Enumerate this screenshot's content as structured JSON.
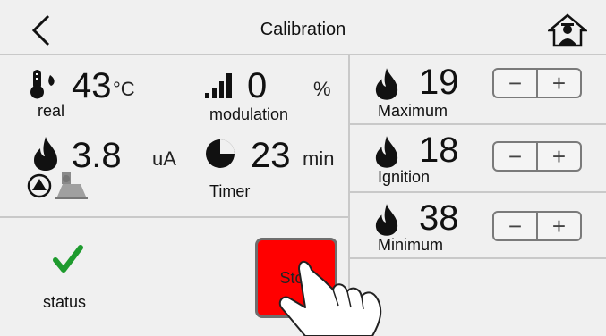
{
  "header": {
    "title": "Calibration"
  },
  "readings": {
    "temperature": {
      "value": "43",
      "unit": "°C",
      "label": "real"
    },
    "modulation": {
      "value": "0",
      "unit": "%",
      "label": "modulation"
    },
    "flame_current": {
      "value": "3.8",
      "unit": "uA"
    },
    "timer": {
      "value": "23",
      "unit": "min",
      "label": "Timer"
    }
  },
  "status": {
    "label": "status",
    "state": "ok"
  },
  "stop_button": {
    "label": "Stop"
  },
  "settings": [
    {
      "value": "19",
      "label": "Maximum",
      "minus": "−",
      "plus": "+"
    },
    {
      "value": "18",
      "label": "Ignition",
      "minus": "−",
      "plus": "+"
    },
    {
      "value": "38",
      "label": "Minimum",
      "minus": "−",
      "plus": "+"
    }
  ],
  "icons": [
    "back-chevron-icon",
    "home-icon",
    "thermometer-icon",
    "signal-bars-icon",
    "flame-icon",
    "clock-icon",
    "fan-icon",
    "chimney-icon",
    "checkmark-icon"
  ],
  "colors": {
    "stop": "#ff0000",
    "check": "#1e9b2e",
    "divider": "#c9c9c9"
  }
}
